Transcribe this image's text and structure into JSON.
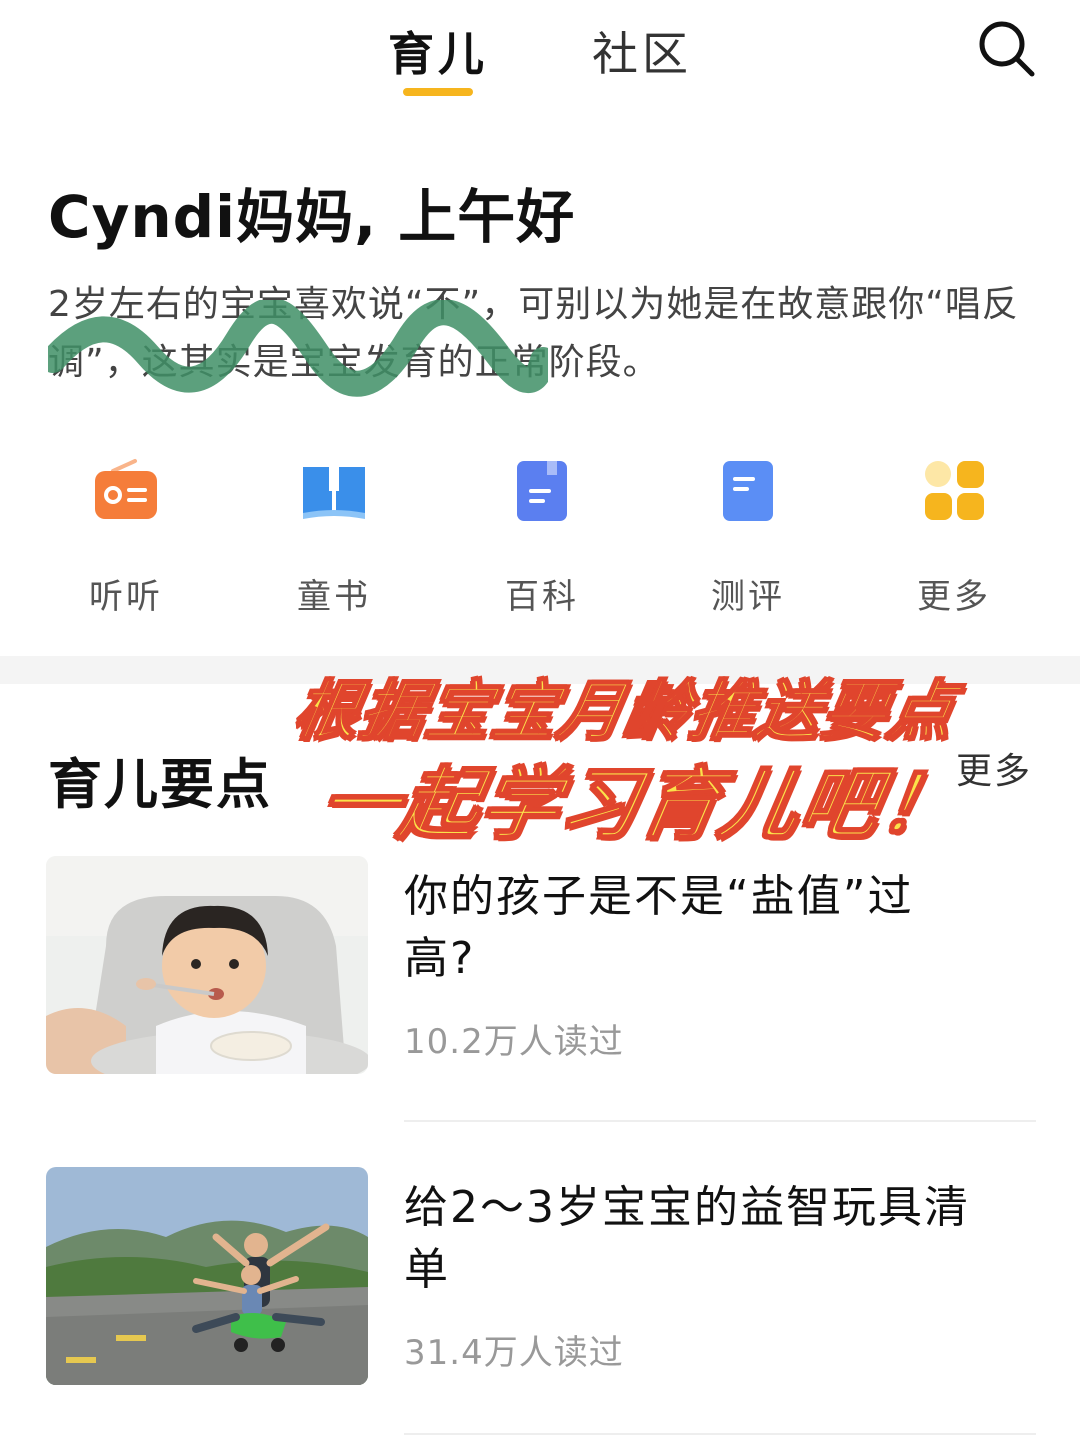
{
  "tabs": [
    {
      "label": "育儿",
      "active": true
    },
    {
      "label": "社区",
      "active": false
    }
  ],
  "search": {
    "icon": "search-icon"
  },
  "greeting": "Cyndi妈妈, 上午好",
  "subtitle": "2岁左右的宝宝喜欢说“不”，可别以为她是在故意跟你“唱反调”，这其实是宝宝发育的正常阶段。",
  "quick_entries": [
    {
      "label": "听听",
      "icon": "radio-icon",
      "color": "#f57d3a"
    },
    {
      "label": "童书",
      "icon": "open-book-icon",
      "color": "#3a8fea"
    },
    {
      "label": "百科",
      "icon": "encyclopedia-icon",
      "color": "#5b7ff0"
    },
    {
      "label": "测评",
      "icon": "evaluation-icon",
      "color": "#5b8ef5"
    },
    {
      "label": "更多",
      "icon": "more-grid-icon",
      "color": "#f6b51e"
    }
  ],
  "section": {
    "title": "育儿要点",
    "more": "更多"
  },
  "promo": {
    "line1": "根据宝宝月龄推送要点",
    "line2": "一起学习育儿吧！"
  },
  "articles": [
    {
      "title": "你的孩子是不是“盐值”过高?",
      "reads": "10.2万人读过",
      "image": "toddler-eating-image"
    },
    {
      "title": "给2～3岁宝宝的益智玩具清单",
      "reads": "31.4万人读过",
      "image": "family-riding-toy-image"
    }
  ],
  "colors": {
    "accent": "#f6b51e",
    "promo_fill": "#fbe24a",
    "promo_outline": "#e0452d",
    "wave": "#3f8f66"
  }
}
